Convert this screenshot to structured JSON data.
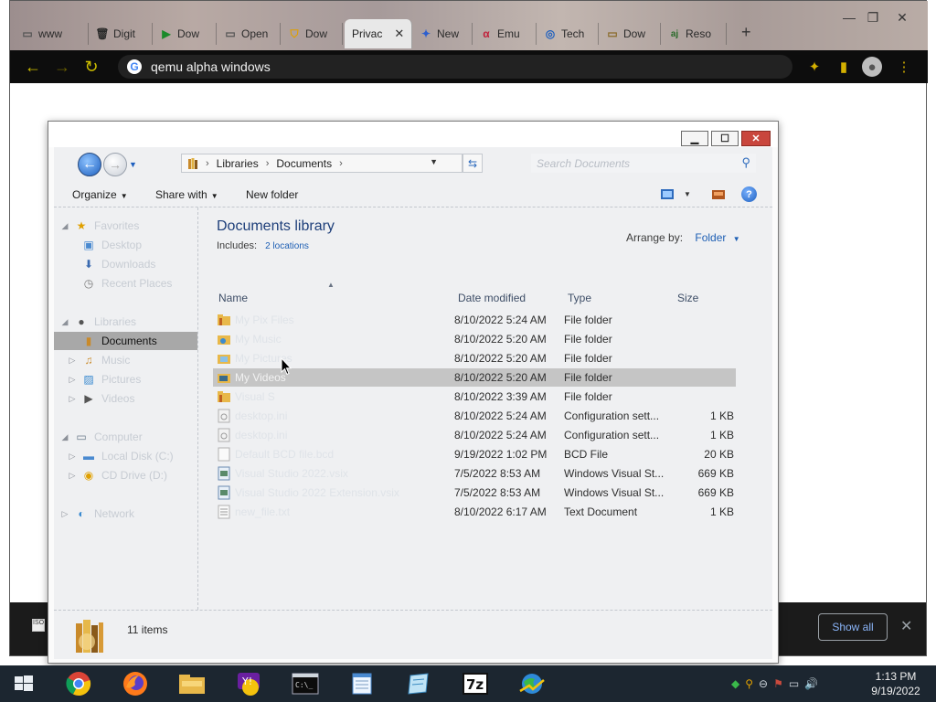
{
  "browser": {
    "tabs": [
      {
        "label": "www",
        "icon": "page-icon"
      },
      {
        "label": "Digit",
        "icon": "trash-icon"
      },
      {
        "label": "Dow",
        "icon": "play-icon"
      },
      {
        "label": "Open",
        "icon": "page-icon"
      },
      {
        "label": "Dow",
        "icon": "shield-icon"
      },
      {
        "label": "Privac",
        "icon": "none",
        "active": true
      },
      {
        "label": "New",
        "icon": "puzzle-icon"
      },
      {
        "label": "Emu",
        "icon": "alpha-icon"
      },
      {
        "label": "Tech",
        "icon": "globe-icon"
      },
      {
        "label": "Dow",
        "icon": "page-icon"
      },
      {
        "label": "Reso",
        "icon": "aj-icon"
      }
    ],
    "address": "qemu alpha windows",
    "download_bar": {
      "show_all": "Show all"
    }
  },
  "explorer": {
    "breadcrumb": [
      "Libraries",
      "Documents"
    ],
    "search_placeholder": "Search Documents",
    "commands": {
      "organize": "Organize",
      "share_with": "Share with",
      "new_folder": "New folder"
    },
    "nav": [
      {
        "label": "Favorites",
        "icon": "star-icon",
        "level": 0,
        "expander": "down"
      },
      {
        "label": "Desktop",
        "icon": "desktop-icon",
        "level": 1
      },
      {
        "label": "Downloads",
        "icon": "downloads-icon",
        "level": 1
      },
      {
        "label": "Recent Places",
        "icon": "recent-icon",
        "level": 1
      },
      {
        "label": "Libraries",
        "icon": "libraries-icon",
        "level": 0,
        "expander": "down"
      },
      {
        "label": "Documents",
        "icon": "documents-icon",
        "level": 1,
        "selected": true
      },
      {
        "label": "Music",
        "icon": "music-icon",
        "level": 1,
        "expander": "right"
      },
      {
        "label": "Pictures",
        "icon": "pictures-icon",
        "level": 1,
        "expander": "right"
      },
      {
        "label": "Videos",
        "icon": "videos-icon",
        "level": 1,
        "expander": "right"
      },
      {
        "label": "Computer",
        "icon": "computer-icon",
        "level": 0,
        "expander": "down"
      },
      {
        "label": "Local Disk (C:)",
        "icon": "disk-icon",
        "level": 1,
        "expander": "right"
      },
      {
        "label": "CD Drive (D:)",
        "icon": "cd-icon",
        "level": 1,
        "expander": "right"
      },
      {
        "label": "Network",
        "icon": "network-icon",
        "level": 0,
        "expander": "right"
      }
    ],
    "library": {
      "title": "Documents library",
      "includes_label": "Includes:",
      "includes_link": "2 locations",
      "arrange_label": "Arrange by:",
      "arrange_value": "Folder"
    },
    "columns": {
      "name": "Name",
      "date": "Date modified",
      "type": "Type",
      "size": "Size"
    },
    "files": [
      {
        "name": "My Pix Files",
        "date": "8/10/2022 5:24 AM",
        "type": "File folder",
        "size": "",
        "icon": "folder-icon"
      },
      {
        "name": "My Music",
        "date": "8/10/2022 5:20 AM",
        "type": "File folder",
        "size": "",
        "icon": "music-folder-icon"
      },
      {
        "name": "My Pictures",
        "date": "8/10/2022 5:20 AM",
        "type": "File folder",
        "size": "",
        "icon": "pictures-folder-icon"
      },
      {
        "name": "My Videos",
        "date": "8/10/2022 5:20 AM",
        "type": "File folder",
        "size": "",
        "icon": "videos-folder-icon",
        "highlighted": true
      },
      {
        "name": "Visual S",
        "date": "8/10/2022 3:39 AM",
        "type": "File folder",
        "size": "",
        "icon": "folder-icon"
      },
      {
        "name": "desktop.ini",
        "date": "8/10/2022 5:24 AM",
        "type": "Configuration sett...",
        "size": "1 KB",
        "icon": "config-icon"
      },
      {
        "name": "desktop.ini",
        "date": "8/10/2022 5:24 AM",
        "type": "Configuration sett...",
        "size": "1 KB",
        "icon": "config-icon"
      },
      {
        "name": "Default BCD file.bcd",
        "date": "9/19/2022 1:02 PM",
        "type": "BCD File",
        "size": "20 KB",
        "icon": "file-icon"
      },
      {
        "name": "Visual Studio 2022.vsix",
        "date": "7/5/2022 8:53 AM",
        "type": "Windows Visual St...",
        "size": "669 KB",
        "icon": "vsix-icon"
      },
      {
        "name": "Visual Studio 2022 Extension.vsix",
        "date": "7/5/2022 8:53 AM",
        "type": "Windows Visual St...",
        "size": "669 KB",
        "icon": "vsix-icon"
      },
      {
        "name": "new_file.txt",
        "date": "8/10/2022 6:17 AM",
        "type": "Text Document",
        "size": "1 KB",
        "icon": "text-icon"
      }
    ],
    "item_count": "11 items"
  },
  "taskbar": {
    "apps": [
      "start-icon",
      "chrome-icon",
      "firefox-icon",
      "explorer-icon",
      "yahoo-messenger-icon",
      "cmd-icon",
      "notepad-icon",
      "wordpad-icon",
      "7zip-icon",
      "network-globe-icon"
    ],
    "time": "1:13 PM",
    "date": "9/19/2022"
  }
}
